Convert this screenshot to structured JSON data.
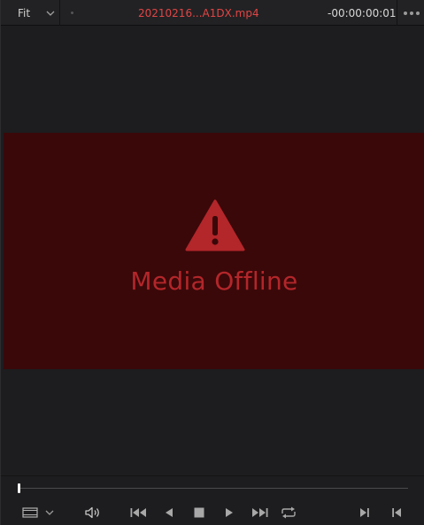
{
  "topbar": {
    "zoom_label": "Fit",
    "clip_name": "20210216...A1DX.mp4",
    "timecode": "-00:00:00:01"
  },
  "viewer": {
    "offline_message": "Media Offline"
  },
  "colors": {
    "clip_name": "#e04545",
    "offline_background": "#3a0809",
    "offline_accent": "#b3262a"
  },
  "transport": {
    "playhead_position_fraction": 0.0,
    "icons": [
      "viewer-options-icon",
      "audio-volume-icon",
      "jump-to-start-icon",
      "play-reverse-icon",
      "stop-icon",
      "play-forward-icon",
      "jump-to-end-icon",
      "loop-icon",
      "next-frame-icon",
      "previous-frame-icon"
    ]
  }
}
